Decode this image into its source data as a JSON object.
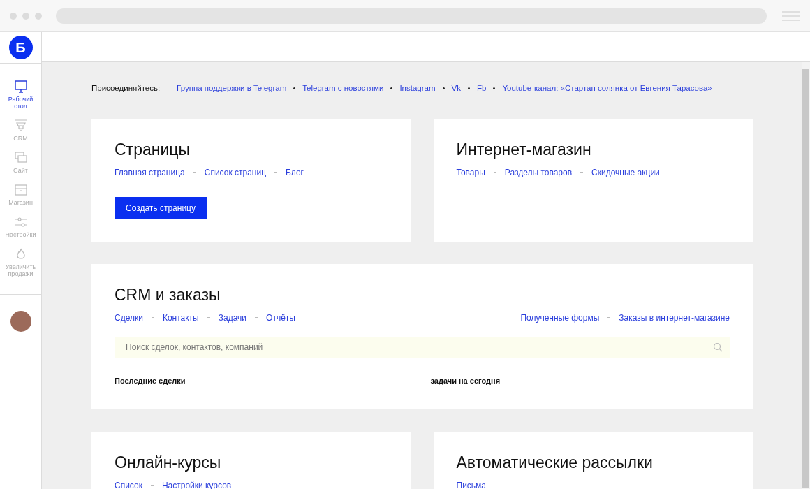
{
  "logo": {
    "letter": "Б"
  },
  "sidebar": {
    "items": [
      {
        "label": "Рабочий стол",
        "kind": "monitor",
        "selected": true
      },
      {
        "label": "CRM",
        "kind": "funnel",
        "selected": false
      },
      {
        "label": "Сайт",
        "kind": "pages",
        "selected": false
      },
      {
        "label": "Магазин",
        "kind": "store",
        "selected": false
      },
      {
        "label": "Настройки",
        "kind": "sliders",
        "selected": false
      },
      {
        "label": "Увеличить продажи",
        "kind": "flame",
        "selected": false
      }
    ]
  },
  "join": {
    "label": "Присоединяйтесь:",
    "links": [
      "Группа поддержки в Telegram",
      "Telegram с новостями",
      "Instagram",
      "Vk",
      "Fb",
      "Youtube-канал: «Стартап солянка от Евгения Тарасова»"
    ]
  },
  "cards": [
    {
      "title": "Страницы",
      "links": [
        "Главная страница",
        "Список страниц",
        "Блог"
      ],
      "button": "Создать страницу"
    },
    {
      "title": "Интернет-магазин",
      "links": [
        "Товары",
        "Разделы товаров",
        "Скидочные акции"
      ]
    },
    {
      "title": "CRM и заказы",
      "wide": true,
      "links": [
        "Сделки",
        "Контакты",
        "Задачи",
        "Отчёты"
      ],
      "links_right": [
        "Полученные формы",
        "Заказы в интернет-магазине"
      ],
      "search": {
        "placeholder": "Поиск сделок, контактов, компаний"
      },
      "sections": [
        "Последние сделки",
        "задачи на сегодня"
      ]
    },
    {
      "title": "Онлайн-курсы",
      "links": [
        "Список",
        "Настройки курсов"
      ]
    },
    {
      "title": "Автоматические рассылки",
      "links": [
        "Письма"
      ]
    }
  ]
}
